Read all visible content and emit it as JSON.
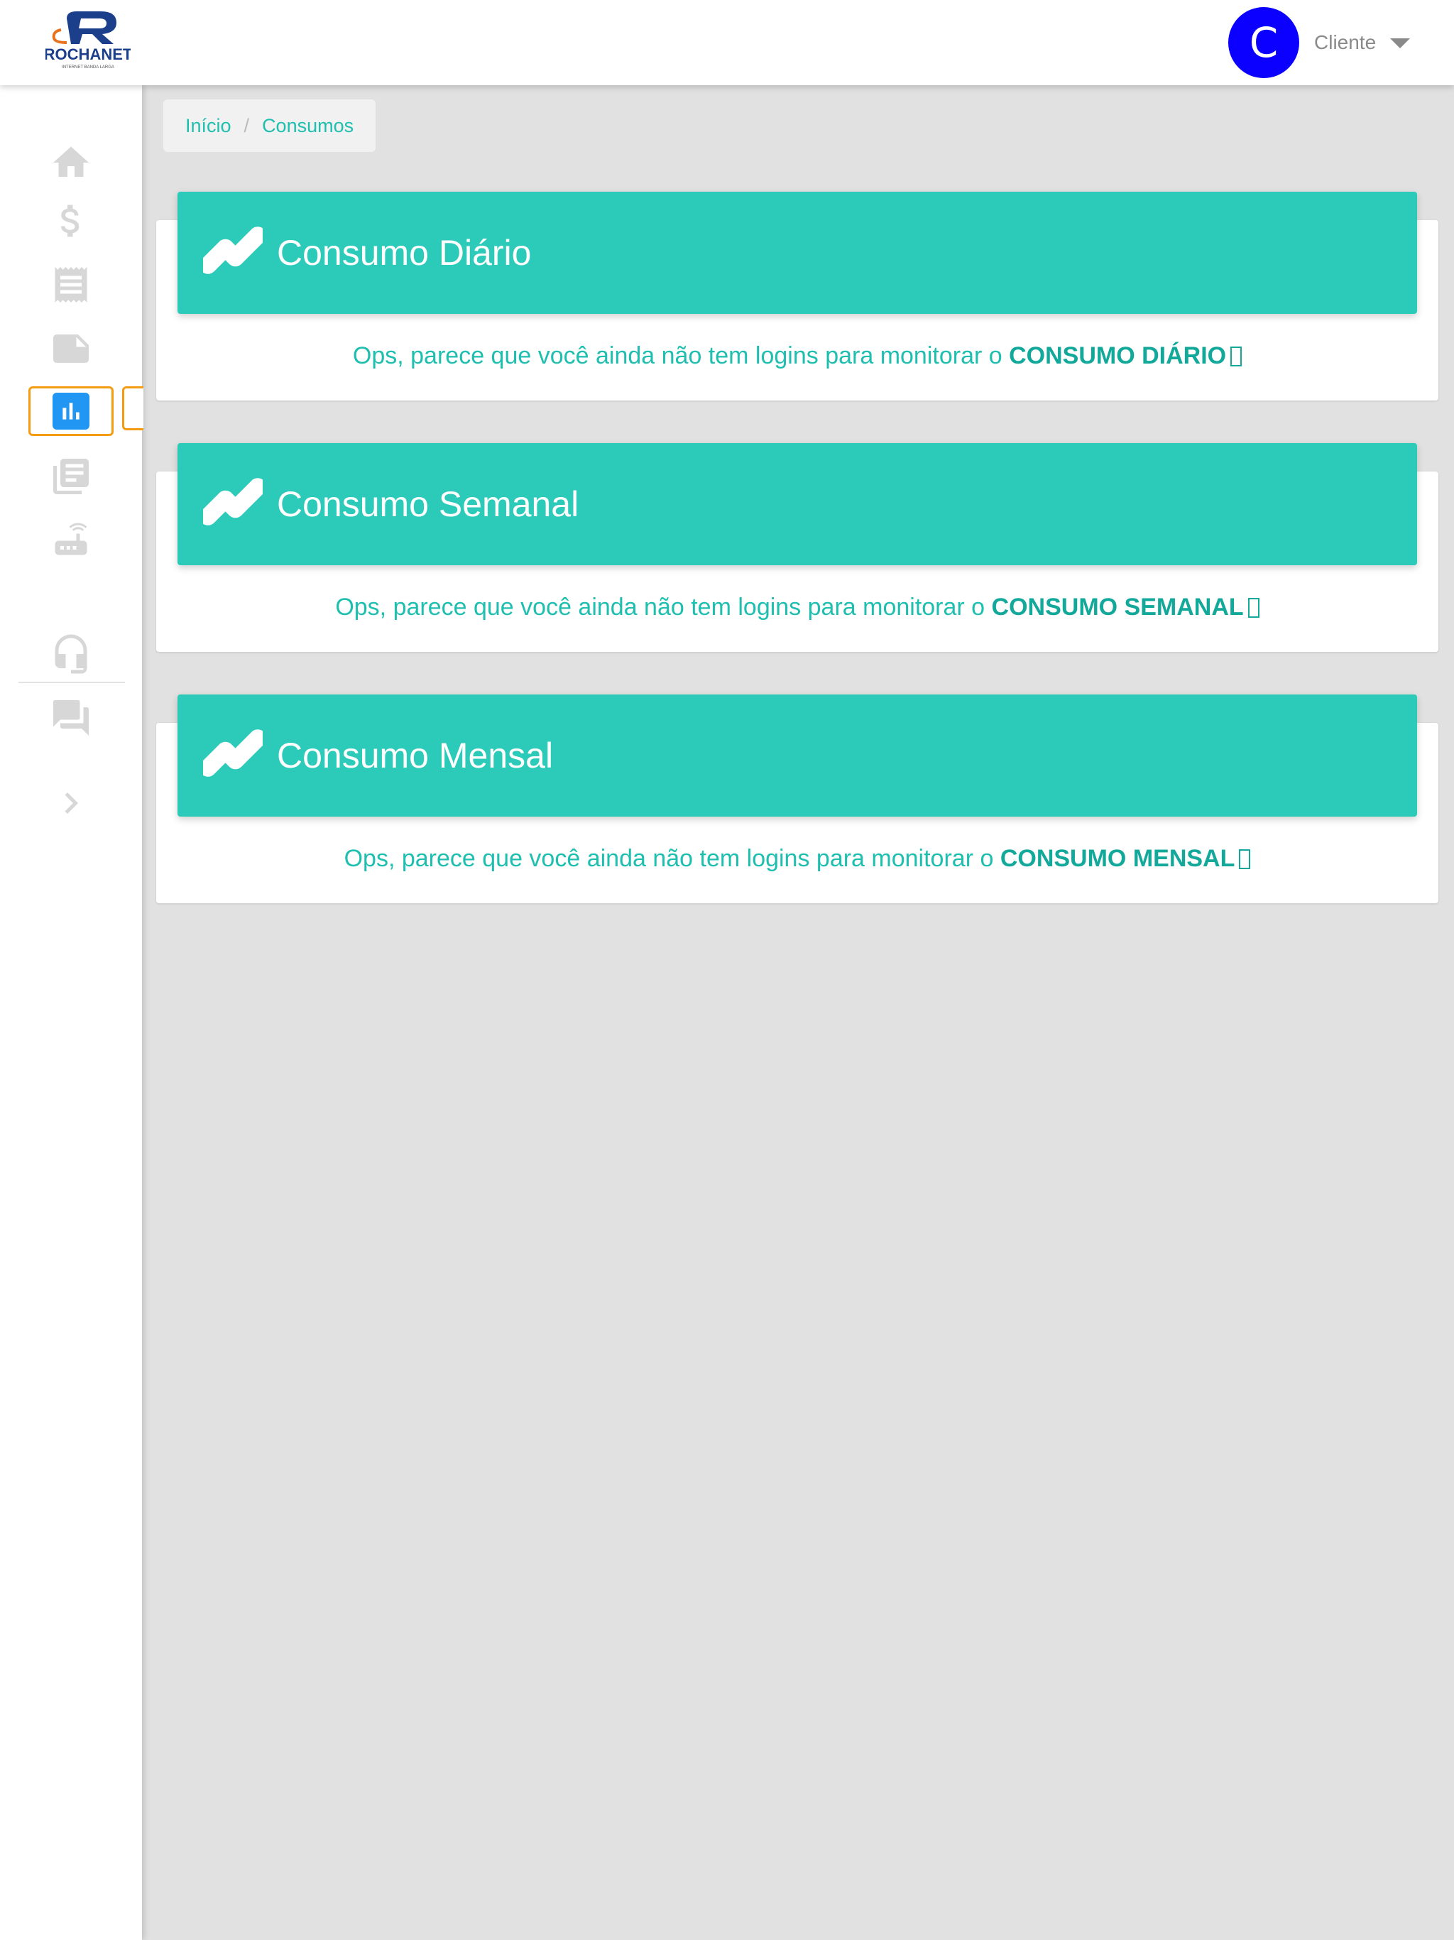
{
  "header": {
    "logo_text": "ROCHANET",
    "logo_tagline": "INTERNET BANDA LARGA",
    "avatar_letter": "C",
    "user_name": "Cliente"
  },
  "sidebar": {
    "items": [
      {
        "icon": "home-icon"
      },
      {
        "icon": "dollar-icon"
      },
      {
        "icon": "receipt-icon"
      },
      {
        "icon": "note-icon"
      },
      {
        "icon": "bar-chart-icon",
        "active": true
      },
      {
        "icon": "library-icon"
      },
      {
        "icon": "router-icon"
      },
      {
        "icon": "headset-icon"
      },
      {
        "icon": "forum-icon"
      },
      {
        "icon": "chevron-right-icon"
      }
    ]
  },
  "breadcrumb": {
    "home": "Início",
    "current": "Consumos"
  },
  "cards": [
    {
      "title": "Consumo Diário",
      "message": "Ops, parece que você ainda não tem logins para monitorar o",
      "highlight": "CONSUMO DIÁRIO"
    },
    {
      "title": "Consumo Semanal",
      "message": "Ops, parece que você ainda não tem logins para monitorar o",
      "highlight": "CONSUMO SEMANAL"
    },
    {
      "title": "Consumo Mensal",
      "message": "Ops, parece que você ainda não tem logins para monitorar o",
      "highlight": "CONSUMO MENSAL"
    }
  ],
  "colors": {
    "accent": "#2ccbb9",
    "text_accent": "#1fbfb0",
    "avatar": "#0b00ff",
    "active_nav": "#2196f3",
    "focus_outline": "#f39c12"
  }
}
